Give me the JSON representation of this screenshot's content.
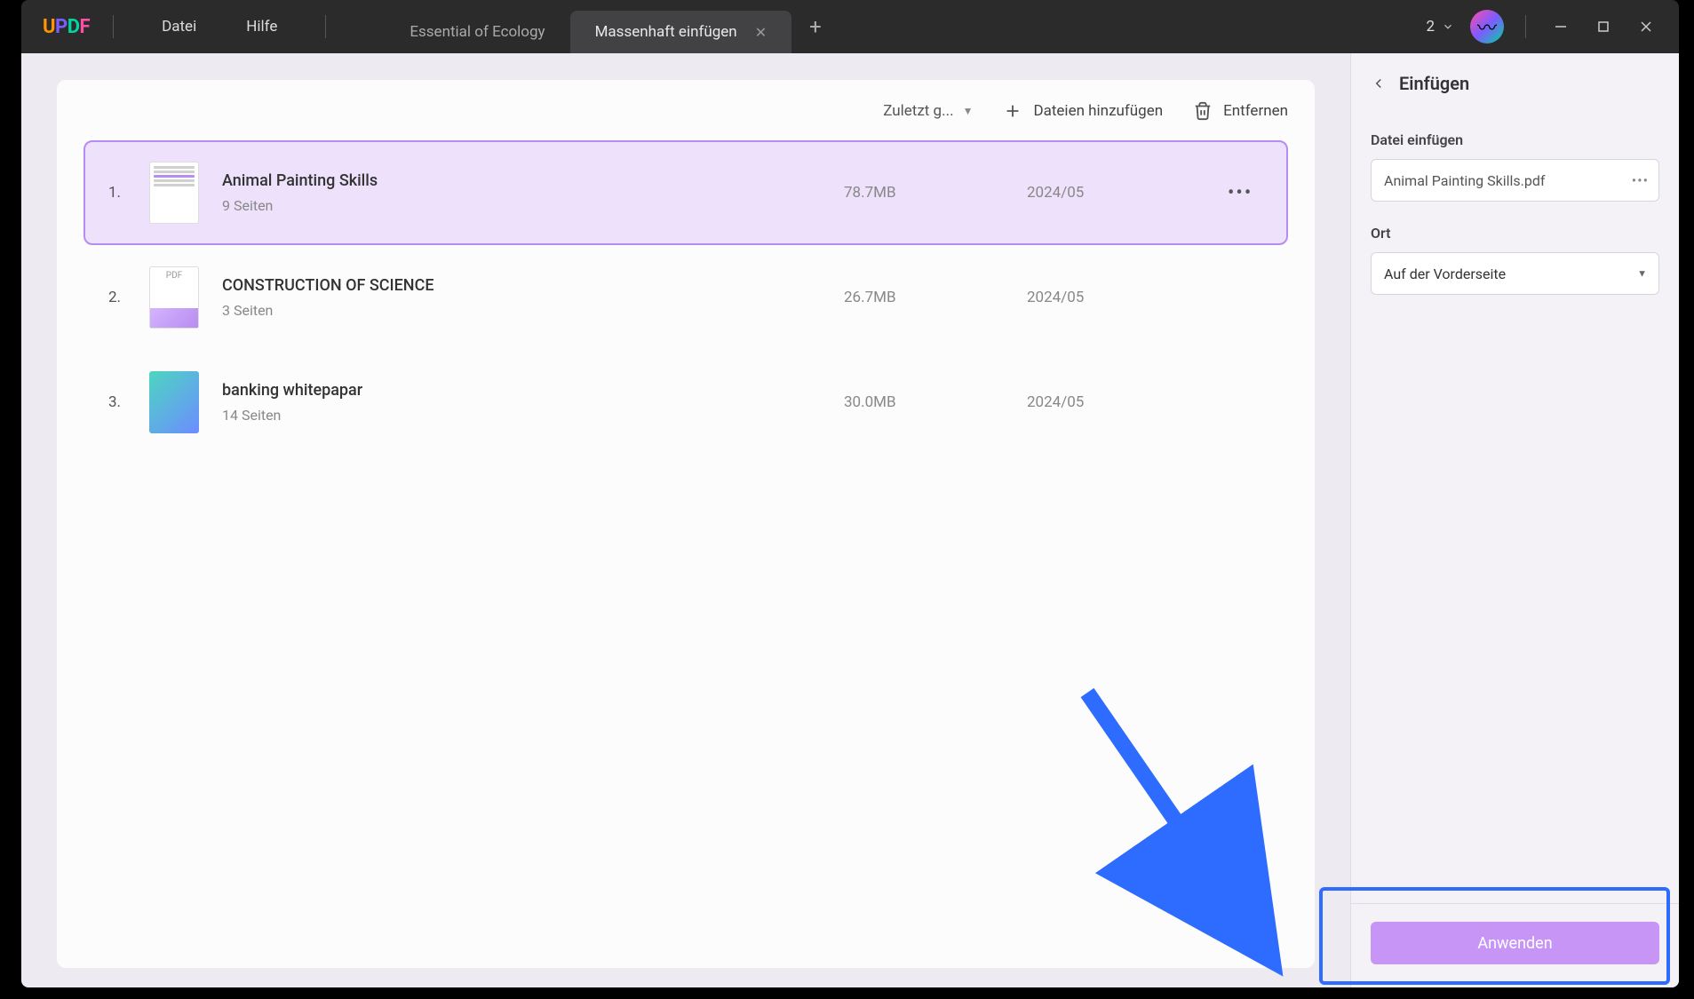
{
  "titlebar": {
    "logo": "UPDF",
    "menu_file": "Datei",
    "menu_help": "Hilfe",
    "tabs": [
      {
        "label": "Essential of Ecology",
        "active": false
      },
      {
        "label": "Massenhaft einfügen",
        "active": true
      }
    ],
    "counter": "2"
  },
  "toolbar": {
    "sort_label": "Zuletzt g...",
    "add_files": "Dateien hinzufügen",
    "remove": "Entfernen"
  },
  "files": [
    {
      "num": "1.",
      "name": "Animal Painting Skills",
      "pages": "9 Seiten",
      "size": "78.7MB",
      "date": "2024/05",
      "selected": true,
      "thumb": "doc"
    },
    {
      "num": "2.",
      "name": "CONSTRUCTION OF SCIENCE",
      "pages": "3 Seiten",
      "size": "26.7MB",
      "date": "2024/05",
      "selected": false,
      "thumb": "pdf"
    },
    {
      "num": "3.",
      "name": "banking whitepapar",
      "pages": "14 Seiten",
      "size": "30.0MB",
      "date": "2024/05",
      "selected": false,
      "thumb": "color"
    }
  ],
  "sidepanel": {
    "title": "Einfügen",
    "label_file": "Datei einfügen",
    "file_value": "Animal Painting Skills.pdf",
    "label_location": "Ort",
    "location_value": "Auf der Vorderseite",
    "apply": "Anwenden"
  }
}
